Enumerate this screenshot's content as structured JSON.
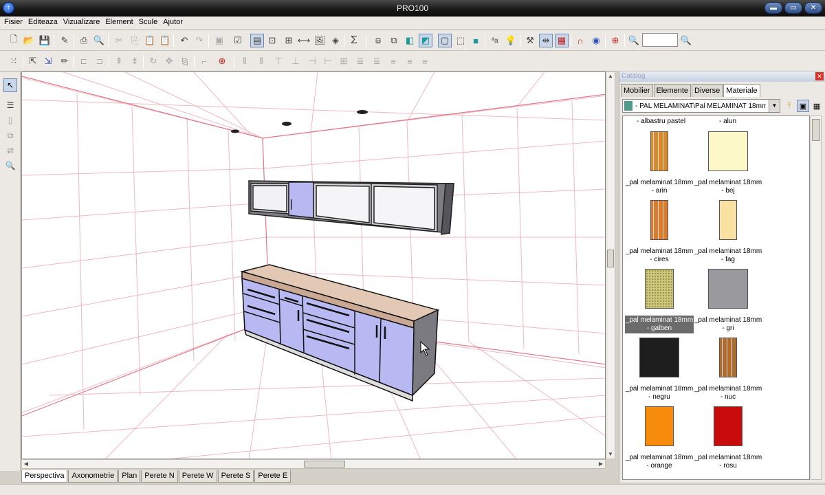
{
  "window": {
    "title": "PRO100"
  },
  "menu": [
    "Fisier",
    "Editeaza",
    "Vizualizare",
    "Element",
    "Scule",
    "Ajutor"
  ],
  "toolbar": {
    "sigma_label": "Σ",
    "text_tool_label": "ªa"
  },
  "view_tabs": [
    {
      "label": "Perspectiva",
      "active": true
    },
    {
      "label": "Axonometrie",
      "active": false
    },
    {
      "label": "Plan",
      "active": false
    },
    {
      "label": "Perete N",
      "active": false
    },
    {
      "label": "Perete W",
      "active": false
    },
    {
      "label": "Perete S",
      "active": false
    },
    {
      "label": "Perete E",
      "active": false
    }
  ],
  "catalog": {
    "title": "Catalog",
    "tabs": [
      {
        "label": "Mobilier",
        "active": false
      },
      {
        "label": "Elemente",
        "active": false
      },
      {
        "label": "Diverse",
        "active": false
      },
      {
        "label": "Materiale",
        "active": true
      }
    ],
    "path": "- PAL MELAMINAT\\Pal MELAMINAT 18mm",
    "top_labels": [
      "- albastru pastel",
      "- alun"
    ],
    "materials": [
      {
        "line1": "_pal melaminat 18mm",
        "line2": "- arin",
        "color": "#d98a2b",
        "pattern": "wood",
        "selected": false
      },
      {
        "line1": "_pal melaminat 18mm",
        "line2": "- bej",
        "color": "#fdf8c8",
        "pattern": "flat",
        "selected": false
      },
      {
        "line1": "_pal melaminat 18mm",
        "line2": "- cires",
        "color": "#dc7a2e",
        "pattern": "wood",
        "selected": false
      },
      {
        "line1": "_pal melaminat 18mm",
        "line2": "- fag",
        "color": "#f8e1a3",
        "pattern": "flat",
        "selected": false
      },
      {
        "line1": "_pal melaminat 18mm",
        "line2": "- galben",
        "color": "#cdc879",
        "pattern": "dots",
        "selected": true
      },
      {
        "line1": "_pal melaminat 18mm",
        "line2": "- gri",
        "color": "#9a999e",
        "pattern": "flat",
        "selected": false
      },
      {
        "line1": "_pal melaminat 18mm",
        "line2": "- negru",
        "color": "#1e1e1e",
        "pattern": "flat",
        "selected": false
      },
      {
        "line1": "_pal melaminat 18mm",
        "line2": "- nuc",
        "color": "#b06a2c",
        "pattern": "wood",
        "selected": false
      },
      {
        "line1": "_pal melaminat 18mm",
        "line2": "- orange",
        "color": "#f78b0b",
        "pattern": "flat",
        "selected": false
      },
      {
        "line1": "_pal melaminat 18mm",
        "line2": "- rosu",
        "color": "#c80c0c",
        "pattern": "flat",
        "selected": false
      }
    ]
  },
  "colors": {
    "cabinet_fill": "#b8b8f2",
    "worktop": "#e4c8b6",
    "grid_line": "#e8a0a8"
  }
}
